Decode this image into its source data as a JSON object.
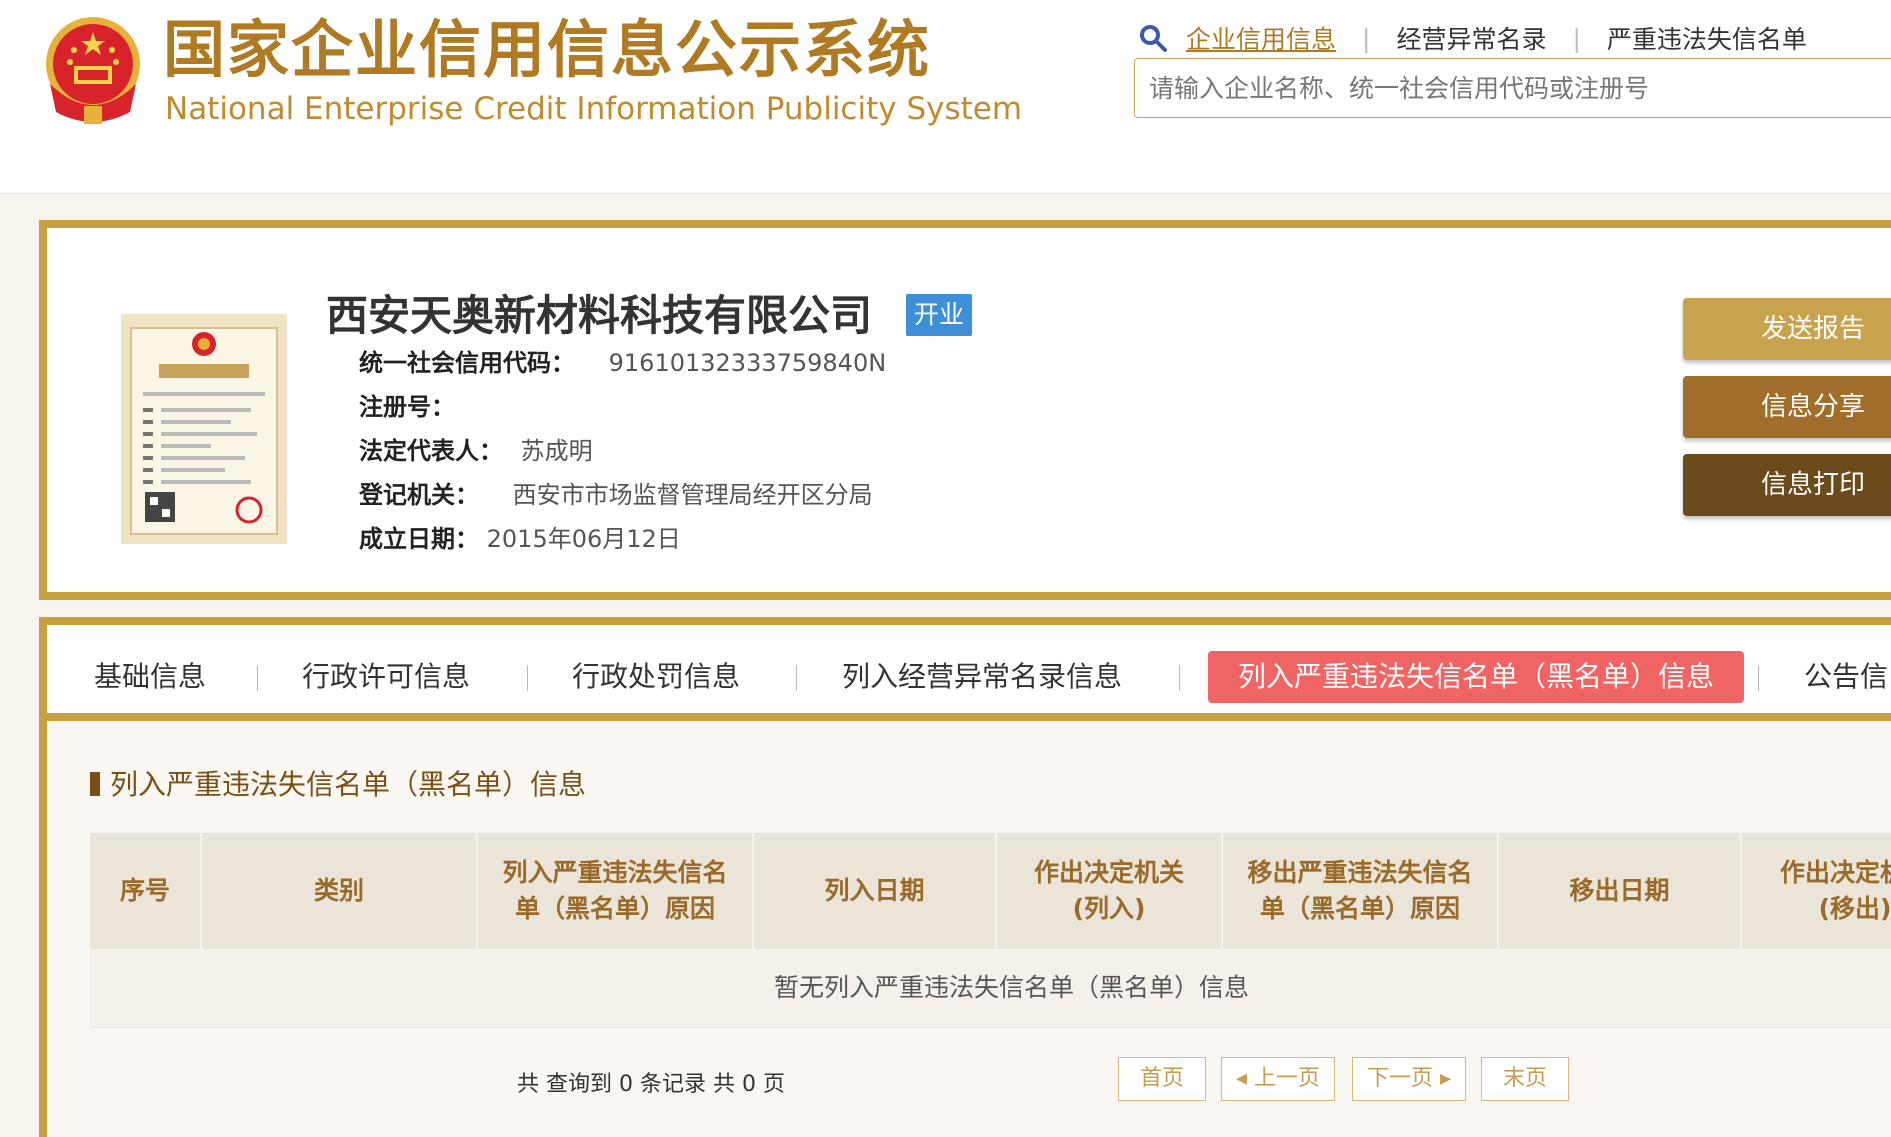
{
  "header": {
    "title_cn": "国家企业信用信息公示系统",
    "title_en": "National Enterprise Credit Information Publicity System",
    "nav": [
      "企业信用信息",
      "经营异常名录",
      "严重违法失信名单"
    ],
    "search_placeholder": "请输入企业名称、统一社会信用代码或注册号",
    "search_icon": "search-icon",
    "emblem_icon": "national-emblem-icon"
  },
  "company": {
    "name": "西安天奥新材料科技有限公司",
    "status": "开业",
    "license_icon": "business-license-icon",
    "fields": {
      "credit_code_label": "统一社会信用代码：",
      "credit_code": "91610132333759840N",
      "reg_no_label": "注册号：",
      "reg_no": "",
      "legal_rep_label": "法定代表人：",
      "legal_rep": "苏成明",
      "authority_label": "登记机关：",
      "authority": "西安市市场监督管理局经开区分局",
      "founded_label": "成立日期：",
      "founded": "2015年06月12日"
    },
    "actions": {
      "send": "发送报告",
      "share": "信息分享",
      "print": "信息打印"
    }
  },
  "tabs": [
    "基础信息",
    "行政许可信息",
    "行政处罚信息",
    "列入经营异常名录信息",
    "列入严重违法失信名单（黑名单）信息",
    "公告信"
  ],
  "active_tab": 4,
  "section": {
    "title": "列入严重违法失信名单（黑名单）信息",
    "columns": [
      "序号",
      "类别",
      "列入严重违法失信名单（黑名单）原因",
      "列入日期",
      "作出决定机关(列入)",
      "移出严重违法失信名单（黑名单）原因",
      "移出日期",
      "作出决定机关(移出)"
    ],
    "empty_text": "暂无列入严重违法失信名单（黑名单）信息"
  },
  "pagination": {
    "summary": "共 查询到 0 条记录 共 0 页",
    "first": "首页",
    "prev": "◂ 上一页",
    "next": "下一页 ▸",
    "last": "末页"
  },
  "colors": {
    "gold": "#c9a03f",
    "title_gold": "#b07a22",
    "active_tab": "#f06464",
    "badge_blue": "#3d8fd8"
  }
}
